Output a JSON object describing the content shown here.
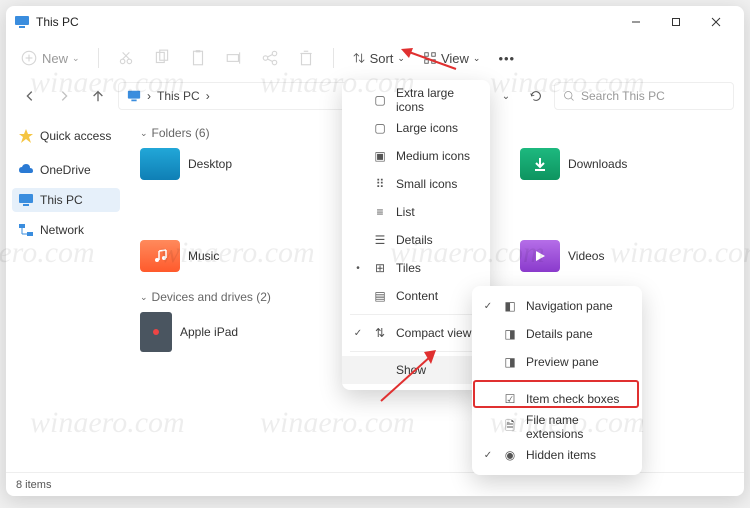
{
  "window": {
    "title": "This PC"
  },
  "toolbar": {
    "new_label": "New",
    "sort_label": "Sort",
    "view_label": "View"
  },
  "breadcrumb": {
    "location": "This PC",
    "sep": "›"
  },
  "search": {
    "placeholder": "Search This PC"
  },
  "sidebar": {
    "items": [
      {
        "label": "Quick access"
      },
      {
        "label": "OneDrive"
      },
      {
        "label": "This PC"
      },
      {
        "label": "Network"
      }
    ]
  },
  "groups": {
    "folders": {
      "title": "Folders (6)"
    },
    "devices": {
      "title": "Devices and drives (2)"
    }
  },
  "folders": [
    {
      "label": "Desktop",
      "color": "#22a7d8"
    },
    {
      "label": "Downloads",
      "color": "#1db97f"
    },
    {
      "label": "Music",
      "color": "#ff6b3d"
    },
    {
      "label": "Videos",
      "color": "#9b4dd8"
    }
  ],
  "devices": [
    {
      "label": "Apple iPad"
    }
  ],
  "view_menu": {
    "items": [
      {
        "label": "Extra large icons"
      },
      {
        "label": "Large icons"
      },
      {
        "label": "Medium icons"
      },
      {
        "label": "Small icons"
      },
      {
        "label": "List"
      },
      {
        "label": "Details"
      },
      {
        "label": "Tiles",
        "checked": true
      },
      {
        "label": "Content"
      },
      {
        "label": "Compact view",
        "checked": true
      }
    ],
    "show_label": "Show"
  },
  "show_menu": {
    "items": [
      {
        "label": "Navigation pane",
        "checked": true
      },
      {
        "label": "Details pane"
      },
      {
        "label": "Preview pane"
      },
      {
        "label": "Item check boxes",
        "highlighted": true
      },
      {
        "label": "File name extensions"
      },
      {
        "label": "Hidden items",
        "checked": true
      }
    ]
  },
  "status": {
    "text": "8 items"
  },
  "watermark": "winaero.com"
}
